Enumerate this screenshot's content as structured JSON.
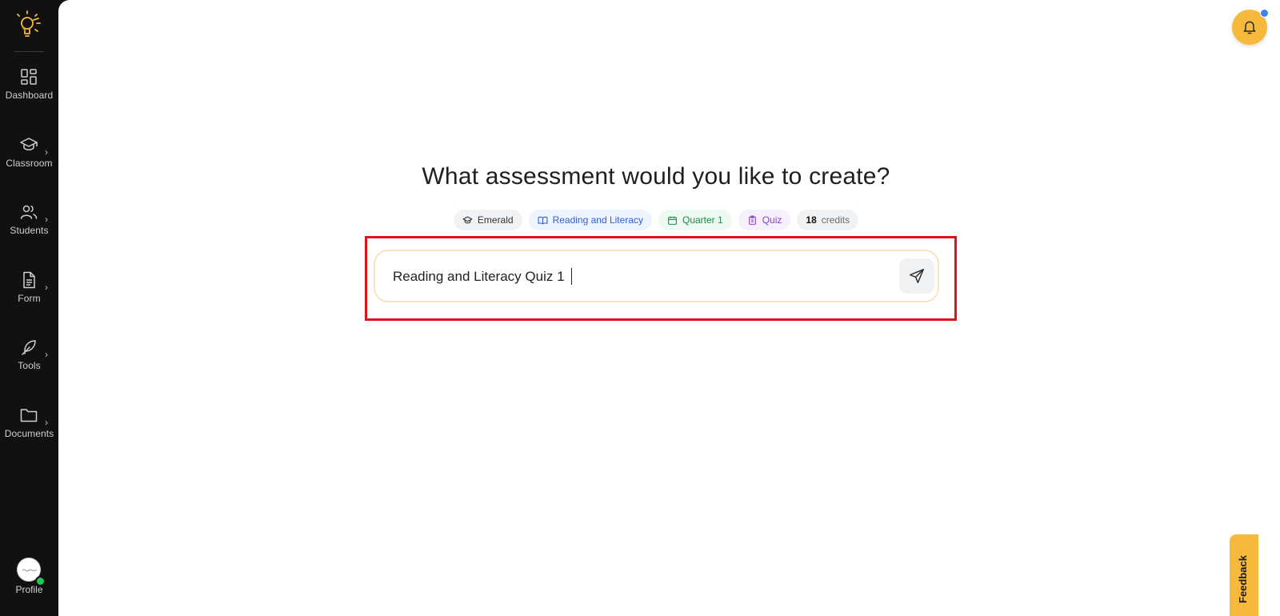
{
  "sidebar": {
    "logo": "lightbulb-logo",
    "items": [
      {
        "label": "Dashboard",
        "icon": "dashboard-grid-icon",
        "has_submenu": false
      },
      {
        "label": "Classroom",
        "icon": "graduation-cap-icon",
        "has_submenu": true
      },
      {
        "label": "Students",
        "icon": "users-icon",
        "has_submenu": true
      },
      {
        "label": "Form",
        "icon": "document-icon",
        "has_submenu": true
      },
      {
        "label": "Tools",
        "icon": "feather-icon",
        "has_submenu": true
      },
      {
        "label": "Documents",
        "icon": "folder-icon",
        "has_submenu": true
      }
    ],
    "profile": {
      "label": "Profile",
      "status": "online"
    }
  },
  "header": {
    "notifications": {
      "icon": "bell-icon",
      "has_unread": true
    }
  },
  "main": {
    "heading": "What assessment would you like to create?",
    "chips": {
      "grade": "Emerald",
      "subject": "Reading and Literacy",
      "quarter": "Quarter 1",
      "type": "Quiz",
      "credits_count": "18",
      "credits_label": "credits"
    },
    "prompt": {
      "value": "Reading and Literacy Quiz 1",
      "send_icon": "send-icon"
    }
  },
  "feedback": {
    "label": "Feedback"
  },
  "colors": {
    "sidebar_bg": "#111111",
    "accent": "#f6b93b",
    "highlight": "#e0121b",
    "subject_chip": "#2f5fd0",
    "quarter_chip": "#1f8a4c",
    "type_chip": "#8b3fc4"
  }
}
